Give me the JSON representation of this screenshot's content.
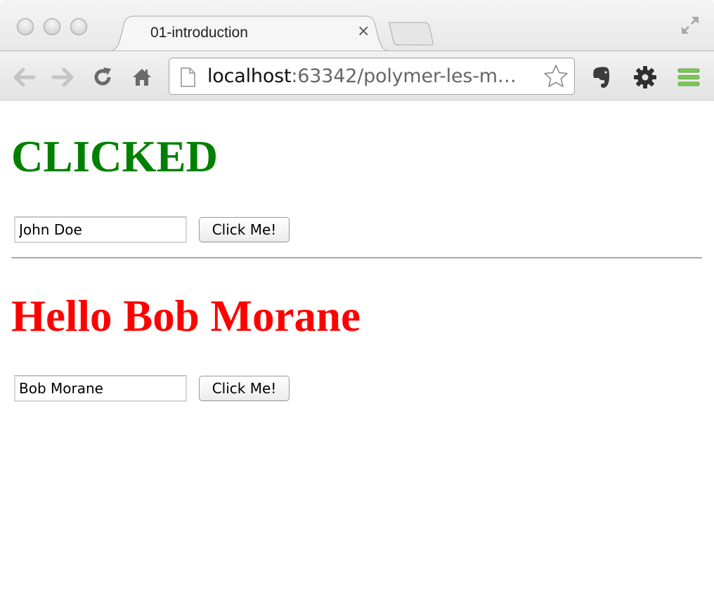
{
  "browser": {
    "tab_title": "01-introduction",
    "tab_close": "×",
    "url_host": "localhost",
    "url_rest": ":63342/polymer-les-m…",
    "icons": [
      "close-light-icon",
      "minimize-light-icon",
      "zoom-light-icon",
      "back-arrow-icon",
      "forward-arrow-icon",
      "reload-icon",
      "home-icon",
      "page-icon",
      "bookmark-star-icon",
      "evernote-icon",
      "gear-icon",
      "menu-icon",
      "fullscreen-icon"
    ],
    "colors": {
      "menu_icon": "#7ec75a"
    }
  },
  "page": {
    "section1": {
      "heading": "CLICKED",
      "heading_color": "#008000",
      "input_value": "John Doe",
      "button_label": "Click Me!"
    },
    "section2": {
      "heading": "Hello Bob Morane",
      "heading_color": "#ff0000",
      "input_value": "Bob Morane",
      "button_label": "Click Me!"
    }
  }
}
